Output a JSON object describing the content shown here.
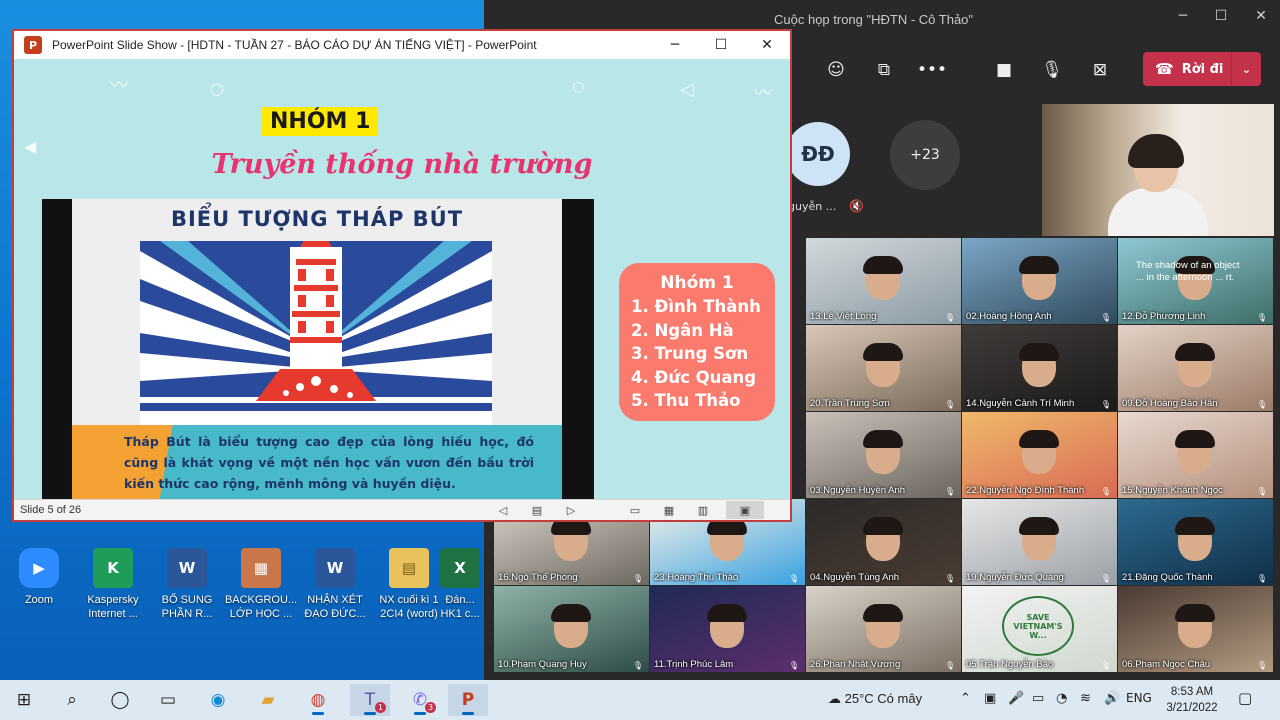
{
  "desktop": {
    "icons": [
      {
        "label": "Zoom",
        "icon": "zoom-icon",
        "color": "#2d8cff"
      },
      {
        "label": "Kaspersky\nInternet ...",
        "icon": "kaspersky-icon",
        "color": "#1e9c5a"
      },
      {
        "label": "BỔ SUNG\nPHẦN R...",
        "icon": "word-icon",
        "color": "#2b579a"
      },
      {
        "label": "BACKGROU...\nLỚP HỌC ...",
        "icon": "image-icon",
        "color": "#c9774a"
      },
      {
        "label": "NHẬN XÉT\nĐẠO ĐỨC...",
        "icon": "word-icon",
        "color": "#2b579a"
      },
      {
        "label": "NX cuối kì 1\n2CI4 (word)",
        "icon": "folder-icon",
        "color": "#e8c25c"
      },
      {
        "label": "Đán...\nHK1 c...",
        "icon": "excel-icon",
        "color": "#1f7244"
      }
    ]
  },
  "ppt": {
    "window_title": "PowerPoint Slide Show - [HDTN - TUẦN 27 - BÁO CÁO DỰ ÁN TIẾNG VIỆT] - PowerPoint",
    "slide": {
      "group_title": "NHÓM 1",
      "subtitle": "Truyền thống nhà trường",
      "poster_heading": "BIỂU TƯỢNG THÁP BÚT",
      "poster_text": "Tháp Bút là biểu tượng cao đẹp của lòng hiếu học, đó cũng là khát vọng về một nền học vấn vươn đến bầu trời kiến thức cao rộng, mênh mông và huyền diệu.",
      "card_heading": "Nhóm 1",
      "members": [
        "1. Đình Thành",
        "2. Ngân Hà",
        "3. Trung Sơn",
        "4. Đức Quang",
        "5. Thu Thảo"
      ]
    },
    "status": "Slide 5 of 26"
  },
  "teams": {
    "title": "Cuộc họp trong \"HĐTN - Cô Thảo\"",
    "leave_label": "Rời đi",
    "avatar_initials": "ĐĐ",
    "avatar_name": "guyễn ...",
    "more_count": "+23",
    "tiles": [
      "13.Lê Việt Long",
      "02.Hoàng Hồng Anh",
      "12.Đỗ Phương Linh",
      "20.Trần Trung Sơn",
      "14.Nguyễn Cảnh Trí Minh",
      "09.Đỗ Hoàng Bảo Hân",
      "03.Nguyễn Huyền Anh",
      "22.Nguyễn Ngô Đình Thành",
      "15.Nguyễn Khánh Ngọc",
      "16.Ngô Thế Phong",
      "23.Hoàng Thu Thảo",
      "04.Nguyễn Tùng Anh",
      "19.Nguyễn Đức Quang",
      "21.Đặng Quốc Thành",
      "10.Phạm Quang Huy",
      "11.Trịnh Phúc Lâm",
      "26.Phan Nhật Vương",
      "05.Trần Nguyễn Bảo",
      "06.Phạm Ngọc Châu"
    ],
    "tile_overlay_text": "The shadow of an object ... in the afternoon ... rt.",
    "save_text": "SAVE VIETNAM'S W..."
  },
  "taskbar": {
    "weather": "25°C  Có mây",
    "lang": "ENG",
    "time": "8:53 AM",
    "date": "3/21/2022",
    "teams_badge": "1",
    "viber_badge": "3"
  },
  "colors": {
    "leave": "#c4314b",
    "slide_bg": "#b9e6e8",
    "card": "#fa7a6e",
    "subtitle": "#e8336f"
  }
}
